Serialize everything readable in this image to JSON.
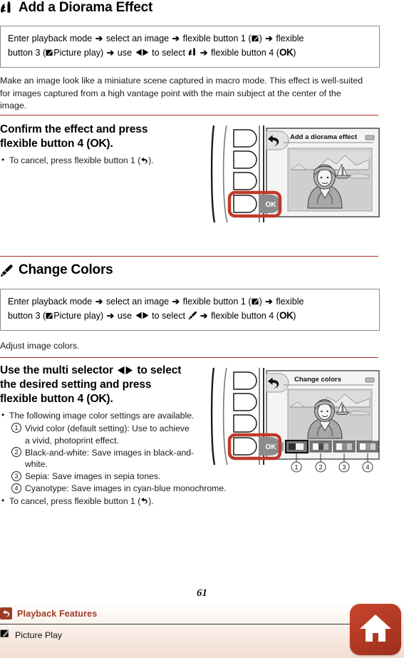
{
  "page": {
    "number": "61"
  },
  "section1": {
    "icon": "diorama-icon",
    "title": "Add a Diorama Effect",
    "procedure": {
      "line1_a": "Enter playback mode",
      "line1_b": "select an image",
      "line1_c": "flexible button 1 (",
      "line1_d": ")",
      "line1_e": "flexible",
      "line2_a": "button 3 (",
      "line2_b": "Picture play)",
      "line2_c": "use",
      "line2_d": "to select",
      "line2_e": "flexible button 4 (",
      "line2_ok": "OK",
      "line2_f": ")"
    },
    "description": "Make an image look like a miniature scene captured in macro mode. This effect is well-suited for images captured from a high vantage point with the main subject at the center of the image.",
    "step": {
      "title_line1": "Confirm the effect and press",
      "title_line2_a": "flexible button 4 (",
      "title_ok": "OK",
      "title_line2_b": ").",
      "bullets": [
        {
          "text_a": "To cancel, press flexible button 1 (",
          "text_b": ")."
        }
      ]
    },
    "screen": {
      "title": "Add a diorama effect",
      "ok_label": "OK"
    }
  },
  "section2": {
    "icon": "change-colors-icon",
    "title": "Change Colors",
    "procedure": {
      "line1_a": "Enter playback mode",
      "line1_b": "select an image",
      "line1_c": "flexible button 1 (",
      "line1_d": ")",
      "line1_e": "flexible",
      "line2_a": "button 3 (",
      "line2_b": "Picture play)",
      "line2_c": "use",
      "line2_d": "to select",
      "line2_e": "flexible button 4 (",
      "line2_ok": "OK",
      "line2_f": ")"
    },
    "description": "Adjust image colors.",
    "step": {
      "title_line1_a": "Use the multi selector",
      "title_line1_b": "to select",
      "title_line2": "the desired setting and press",
      "title_line3_a": "flexible button 4 (",
      "title_ok": "OK",
      "title_line3_b": ").",
      "bullet1": "The following image color settings are available.",
      "options": [
        {
          "num": "1",
          "text": "Vivid color (default setting): Use to achieve a vivid, photoprint effect."
        },
        {
          "num": "2",
          "text": "Black-and-white: Save images in black-and-white."
        },
        {
          "num": "3",
          "text": "Sepia: Save images in sepia tones."
        },
        {
          "num": "4",
          "text": "Cyanotype: Save images in cyan-blue monochrome."
        }
      ],
      "bullet2_a": "To cancel, press flexible button 1 (",
      "bullet2_b": ")."
    },
    "screen": {
      "title": "Change colors",
      "ok_label": "OK",
      "swatch_labels": [
        "1",
        "2",
        "3",
        "4"
      ]
    }
  },
  "footer": {
    "back_icon": "back-arrow-icon",
    "caption1": "Playback Features",
    "picture_play_icon": "picture-play-icon",
    "caption2": "Picture Play",
    "home_icon": "home-icon"
  },
  "colors": {
    "accent_red": "#a93226",
    "footer_red": "#9e3b26",
    "highlight_red": "#c0392b",
    "lcd_frame": "#8d8d8d"
  }
}
